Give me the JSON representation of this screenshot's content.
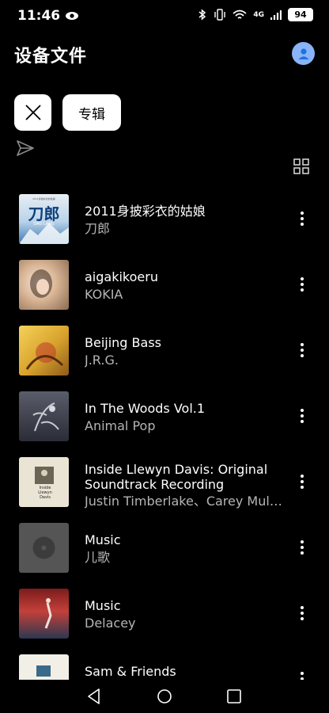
{
  "status_bar": {
    "time": "11:46",
    "battery": "94",
    "signal_label": "4G"
  },
  "header": {
    "title": "设备文件"
  },
  "filters": {
    "album_chip": "专辑"
  },
  "items": [
    {
      "title": "2011身披彩衣的姑娘",
      "artist": "刀郎"
    },
    {
      "title": "aigakikoeru",
      "artist": "KOKIA"
    },
    {
      "title": "Beijing Bass",
      "artist": "J.R.G."
    },
    {
      "title": "In The Woods Vol.1",
      "artist": "Animal Pop"
    },
    {
      "title": "Inside Llewyn Davis: Original Soundtrack Recording",
      "artist": "Justin Timberlake、Carey Mulligan"
    },
    {
      "title": "Music",
      "artist": "儿歌"
    },
    {
      "title": "Music",
      "artist": "Delacey"
    },
    {
      "title": "Sam & Friends",
      "artist": ""
    }
  ],
  "cover_art": [
    {
      "art_text_1": "2011身披彩衣的姑娘",
      "art_text_2": "刀郎",
      "art_text_3": "DAO LANG"
    },
    {
      "art_text_1": ""
    },
    {
      "art_text_1": ""
    },
    {
      "art_text_1": ""
    },
    {
      "art_text_1": "Inside Llewyn Davis"
    },
    {
      "art_text_1": ""
    },
    {
      "art_text_1": ""
    },
    {
      "art_text_1": ""
    }
  ],
  "icons": {
    "close": "close-icon",
    "send": "send-icon",
    "grid": "grid-view-icon",
    "more": "more-vert-icon",
    "back": "back-triangle-icon",
    "home": "home-circle-icon",
    "recents": "recents-square-icon"
  },
  "colors": {
    "background": "#000000",
    "accent_avatar": "#8ab4f8",
    "secondary_text": "#b5b5b5"
  }
}
